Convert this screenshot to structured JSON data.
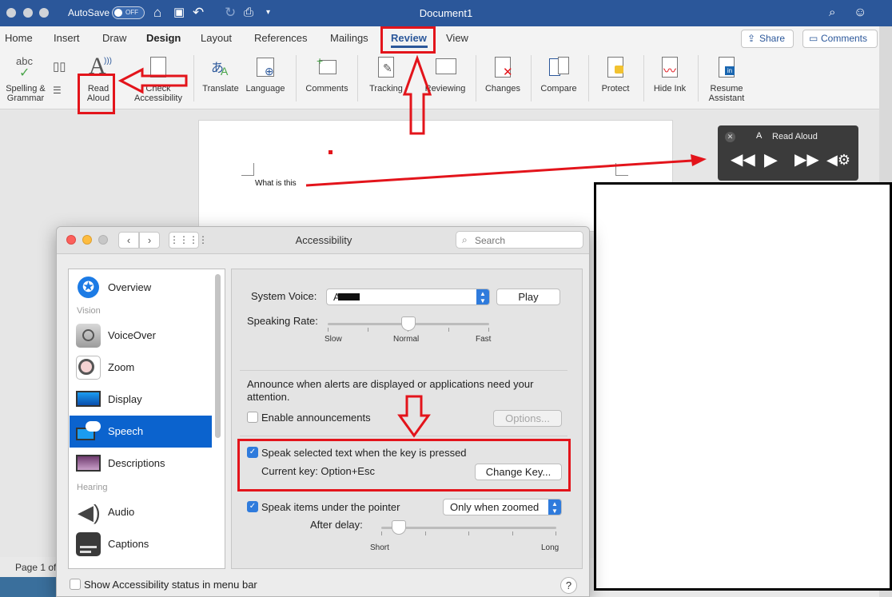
{
  "word": {
    "autosave_label": "AutoSave",
    "autosave_state": "OFF",
    "doc_title": "Document1",
    "tabs": [
      "Home",
      "Insert",
      "Draw",
      "Design",
      "Layout",
      "References",
      "Mailings",
      "Review",
      "View"
    ],
    "active_tab": "Review",
    "share_label": "Share",
    "comments_label": "Comments",
    "ribbon": {
      "spelling": "Spelling &\nGrammar",
      "read_aloud": "Read\nAloud",
      "accessibility": "Check\nAccessibility",
      "translate": "Translate",
      "language": "Language",
      "comments": "Comments",
      "tracking": "Tracking",
      "reviewing": "Reviewing",
      "changes": "Changes",
      "compare": "Compare",
      "protect": "Protect",
      "hide_ink": "Hide Ink",
      "resume": "Resume\nAssistant",
      "abc": "abc"
    },
    "doc_text": "What is this",
    "status": "Page 1 of",
    "read_aloud_title": "Read Aloud"
  },
  "prefs": {
    "title": "Accessibility",
    "search_placeholder": "Search",
    "sidebar": {
      "overview": "Overview",
      "vision_header": "Vision",
      "voiceover": "VoiceOver",
      "zoom": "Zoom",
      "display": "Display",
      "speech": "Speech",
      "descriptions": "Descriptions",
      "hearing_header": "Hearing",
      "audio": "Audio",
      "captions": "Captions"
    },
    "selected_item": "Speech",
    "speech": {
      "system_voice_label": "System Voice:",
      "system_voice_value": "A",
      "play_label": "Play",
      "rate_label": "Speaking Rate:",
      "rate_slow": "Slow",
      "rate_normal": "Normal",
      "rate_fast": "Fast",
      "rate_level": 0.5,
      "announce_text": "Announce when alerts are displayed or applications need your attention.",
      "enable_announcements": "Enable announcements",
      "enable_announcements_checked": false,
      "options_label": "Options...",
      "speak_selected": "Speak selected text when the key is pressed",
      "speak_selected_checked": true,
      "current_key": "Current key: Option+Esc",
      "change_key": "Change Key...",
      "speak_pointer": "Speak items under the pointer",
      "speak_pointer_checked": true,
      "pointer_mode": "Only when zoomed",
      "after_delay": "After delay:",
      "delay_short": "Short",
      "delay_long": "Long",
      "delay_level": 0.1
    },
    "show_status": "Show Accessibility status in menu bar",
    "show_status_checked": false,
    "help": "?"
  },
  "colors": {
    "word_blue": "#2b579a",
    "annotation_red": "#e3141b",
    "selection_blue": "#0b63ce",
    "control_blue": "#2f7bdc"
  }
}
